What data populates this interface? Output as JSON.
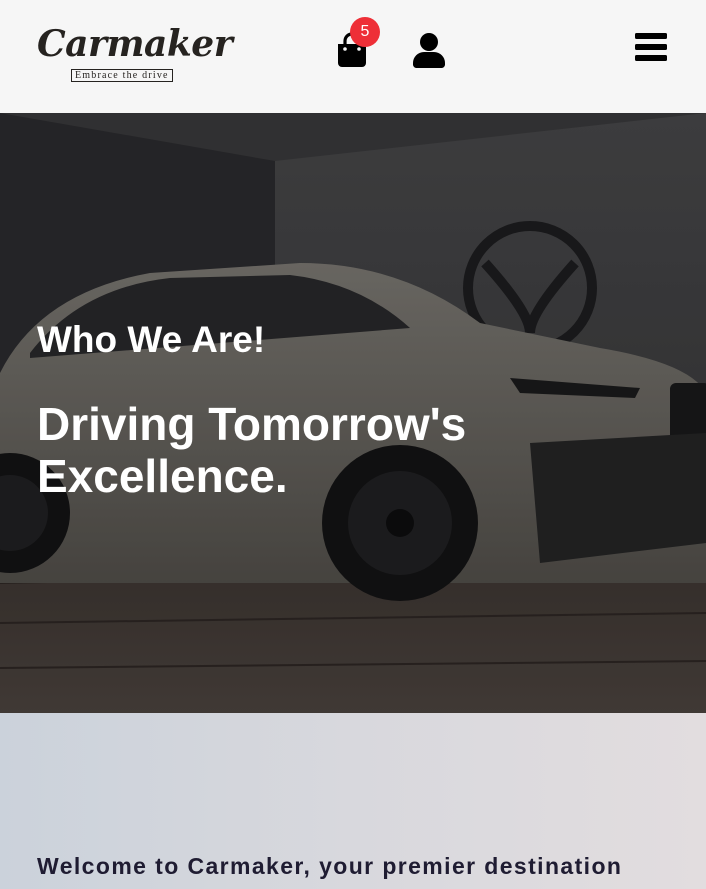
{
  "header": {
    "logo": {
      "name": "Carmaker",
      "tagline": "Embrace the drive"
    },
    "cart": {
      "icon": "shopping-bag-icon",
      "count": "5",
      "badge_color": "#ee2f37"
    },
    "user": {
      "icon": "user-icon"
    },
    "menu": {
      "icon": "hamburger-menu-icon"
    }
  },
  "hero": {
    "kicker": "Who We Are!",
    "title": "Driving Tomorrow's Excellence."
  },
  "about": {
    "intro": "Welcome to Carmaker, your premier destination"
  },
  "colors": {
    "header_bg": "#f6f6f6",
    "icon": "#000000",
    "hero_text": "#ffffff",
    "about_text": "#1f1c32"
  }
}
